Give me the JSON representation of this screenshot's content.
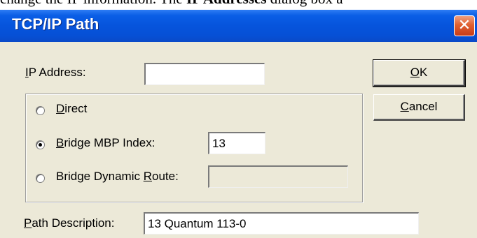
{
  "doc_text": {
    "pre": "change the IP information. The ",
    "bold": "IP Addresses",
    "post": " dialog box a"
  },
  "dialog": {
    "title": "TCP/IP Path",
    "close_glyph": "✕"
  },
  "ip_address": {
    "label_access": "I",
    "label_rest": "P Address:",
    "value": ""
  },
  "buttons": {
    "ok_access": "O",
    "ok_rest": "K",
    "cancel_access": "C",
    "cancel_rest": "ancel"
  },
  "connection": {
    "selected": "bridge_mbp_index",
    "direct": {
      "access": "D",
      "rest": "irect"
    },
    "bridge_mbp": {
      "access": "B",
      "rest": "ridge MBP Index:",
      "value": "13"
    },
    "bridge_dynamic": {
      "pre": "Bridge Dynamic ",
      "access": "R",
      "post": "oute:",
      "value": ""
    }
  },
  "path_description": {
    "label_access": "P",
    "label_rest": "ath Description:",
    "value": "13 Quantum 113-0"
  }
}
